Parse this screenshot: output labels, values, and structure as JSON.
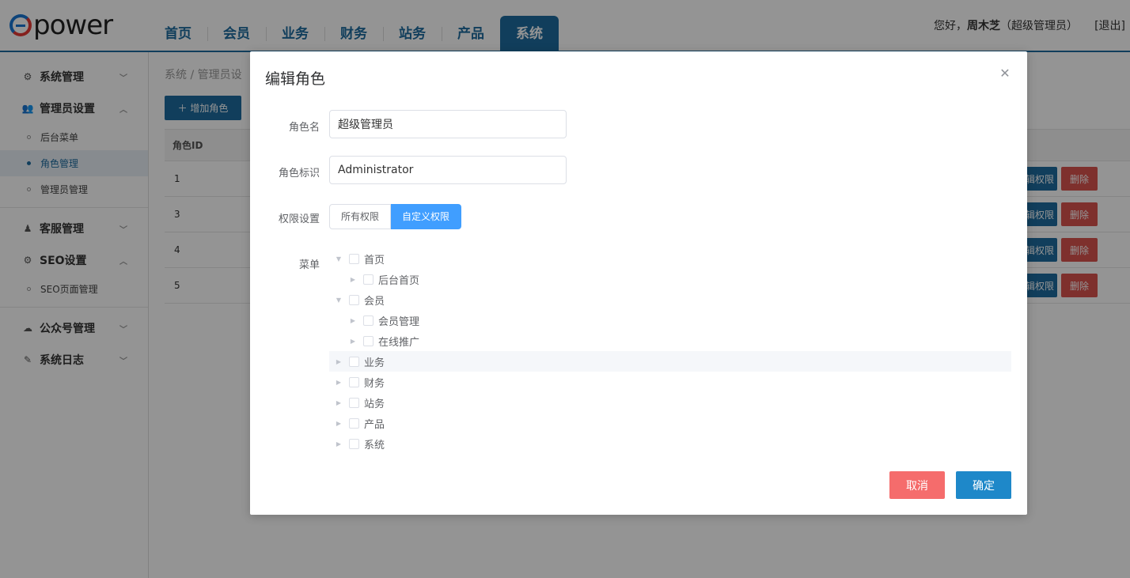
{
  "header": {
    "logo_text": "power",
    "nav": [
      "首页",
      "会员",
      "业务",
      "财务",
      "站务",
      "产品",
      "系统"
    ],
    "active_nav": "系统",
    "greeting_prefix": "您好，",
    "user_name": "周木芝",
    "user_role": "（超级管理员）",
    "logout": "[退出]"
  },
  "sidebar": {
    "groups": [
      {
        "label": "系统管理",
        "icon": "gears-icon",
        "expanded": false,
        "items": []
      },
      {
        "label": "管理员设置",
        "icon": "users-icon",
        "expanded": true,
        "items": [
          "后台菜单",
          "角色管理",
          "管理员管理"
        ],
        "active_item": "角色管理"
      },
      {
        "label": "客服管理",
        "icon": "headset-icon",
        "expanded": false,
        "items": []
      },
      {
        "label": "SEO设置",
        "icon": "gear-icon",
        "expanded": true,
        "items": [
          "SEO页面管理"
        ]
      },
      {
        "label": "公众号管理",
        "icon": "wechat-icon",
        "expanded": false,
        "items": []
      },
      {
        "label": "系统日志",
        "icon": "log-icon",
        "expanded": false,
        "items": []
      }
    ]
  },
  "main": {
    "breadcrumb": "系统  /  管理员设",
    "add_button": "＋ 增加角色",
    "table": {
      "header_id": "角色ID",
      "rows": [
        {
          "id": "1",
          "edit": "编辑权限",
          "delete": "删除"
        },
        {
          "id": "3",
          "edit": "编辑权限",
          "delete": "删除"
        },
        {
          "id": "4",
          "edit": "编辑权限",
          "delete": "删除"
        },
        {
          "id": "5",
          "edit": "编辑权限",
          "delete": "删除"
        }
      ]
    }
  },
  "modal": {
    "title": "编辑角色",
    "role_name_label": "角色名",
    "role_name_value": "超级管理员",
    "role_key_label": "角色标识",
    "role_key_value": "Administrator",
    "permission_label": "权限设置",
    "permission_options": [
      "所有权限",
      "自定义权限"
    ],
    "permission_selected": "自定义权限",
    "menu_label": "菜单",
    "tree": [
      {
        "label": "首页",
        "level": 1,
        "expanded": true
      },
      {
        "label": "后台首页",
        "level": 2,
        "expanded": false
      },
      {
        "label": "会员",
        "level": 1,
        "expanded": true
      },
      {
        "label": "会员管理",
        "level": 2,
        "expanded": false
      },
      {
        "label": "在线推广",
        "level": 2,
        "expanded": false
      },
      {
        "label": "业务",
        "level": 1,
        "expanded": false
      },
      {
        "label": "财务",
        "level": 1,
        "expanded": false
      },
      {
        "label": "站务",
        "level": 1,
        "expanded": false
      },
      {
        "label": "产品",
        "level": 1,
        "expanded": false
      },
      {
        "label": "系统",
        "level": 1,
        "expanded": false
      }
    ],
    "cancel": "取消",
    "confirm": "确定"
  },
  "colors": {
    "brand": "#1e6c9f",
    "primary": "#409eff",
    "danger": "#f56c6c",
    "confirm": "#1e88c9"
  }
}
